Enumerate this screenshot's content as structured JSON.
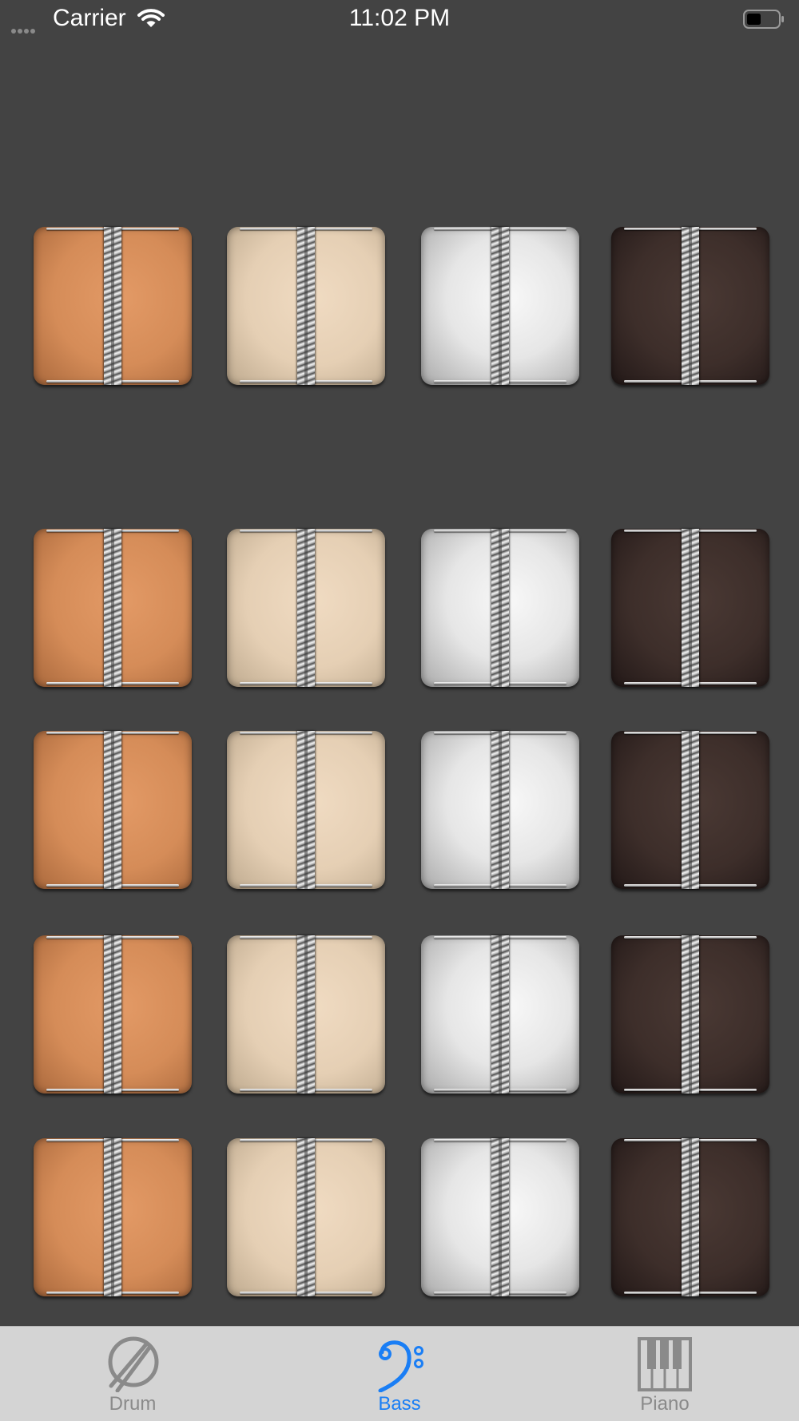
{
  "status_bar": {
    "carrier": "Carrier",
    "time": "11:02 PM",
    "battery_level": 0.45
  },
  "pad_colors": {
    "orange": "#d58c58",
    "cream": "#e5cfb4",
    "silver": "#e6e6e6",
    "dark": "#3d2e2a"
  },
  "pad_grid": {
    "rows": 5,
    "columns": [
      "orange",
      "cream",
      "silver",
      "dark"
    ]
  },
  "tab_bar": {
    "active_color": "#1a7ef5",
    "inactive_color": "#8a8a8a",
    "tabs": [
      {
        "label": "Drum",
        "icon": "drum-icon",
        "active": false
      },
      {
        "label": "Bass",
        "icon": "bass-clef-icon",
        "active": true
      },
      {
        "label": "Piano",
        "icon": "piano-icon",
        "active": false
      }
    ]
  }
}
